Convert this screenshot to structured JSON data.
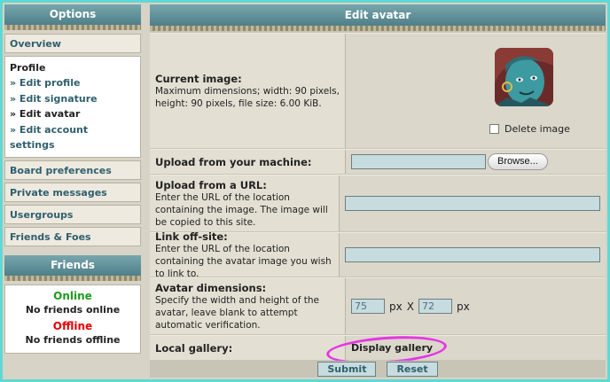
{
  "sidebar": {
    "options_header": "Options",
    "overview": "Overview",
    "profile": {
      "title": "Profile",
      "edit_profile": "» Edit profile",
      "edit_signature": "» Edit signature",
      "edit_avatar": "» Edit avatar",
      "edit_account_settings": "» Edit account settings"
    },
    "board_preferences": "Board preferences",
    "private_messages": "Private messages",
    "usergroups": "Usergroups",
    "friends_foes": "Friends & Foes",
    "friends_header": "Friends",
    "online_label": "Online",
    "no_friends_online": "No friends online",
    "offline_label": "Offline",
    "no_friends_offline": "No friends offline"
  },
  "main": {
    "header": "Edit avatar",
    "current_image": {
      "label": "Current image:",
      "desc": "Maximum dimensions; width: 90 pixels, height: 90 pixels, file size: 6.00 KiB.",
      "delete_label": "Delete image"
    },
    "upload_machine": {
      "label": "Upload from your machine:",
      "browse": "Browse..."
    },
    "upload_url": {
      "label": "Upload from a URL:",
      "desc": "Enter the URL of the location containing the image. The image will be copied to this site."
    },
    "link_offsite": {
      "label": "Link off-site:",
      "desc": "Enter the URL of the location containing the avatar image you wish to link to."
    },
    "dimensions": {
      "label": "Avatar dimensions:",
      "desc": "Specify the width and height of the avatar, leave blank to attempt automatic verification.",
      "width": "75",
      "height": "72",
      "px": "px",
      "x": "X"
    },
    "gallery": {
      "label": "Local gallery:",
      "link": "Display gallery"
    },
    "submit": "Submit",
    "reset": "Reset"
  },
  "colors": {
    "accent_header": "#5f8f99",
    "link": "#2f5f6e",
    "online": "#1f9b1f",
    "offline": "#e80000",
    "highlight_circle": "#e635e6"
  }
}
